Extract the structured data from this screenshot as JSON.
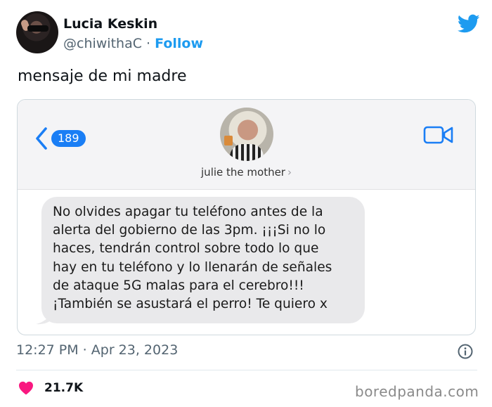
{
  "author": {
    "name": "Lucia Keskin",
    "handle": "@chiwithaC",
    "separator": "·",
    "follow_label": "Follow"
  },
  "tweet": {
    "text": "mensaje de mi madre",
    "timestamp": "12:27 PM · Apr 23, 2023",
    "like_count": "21.7K"
  },
  "screenshot": {
    "unread_count": "189",
    "contact_name": "julie the mother",
    "contact_chevron": "›",
    "message": "No olvides apagar tu teléfono antes de la\nalerta del gobierno de las 3pm. ¡¡¡Si no lo\nhaces, tendrán control sobre todo lo que\nhay en tu teléfono y lo llenarán de señales\nde ataque 5G malas para el cerebro!!!\n¡También se asustará el perro! Te quiero x"
  },
  "watermark": "boredpanda.com",
  "colors": {
    "twitter_blue": "#1d9bf0",
    "ios_blue": "#1a7ef5",
    "like_pink": "#f91880",
    "bubble_gray": "#e9e9eb"
  },
  "icons": [
    "twitter-bird-icon",
    "back-chevron-icon",
    "video-camera-icon",
    "info-icon",
    "heart-icon"
  ]
}
